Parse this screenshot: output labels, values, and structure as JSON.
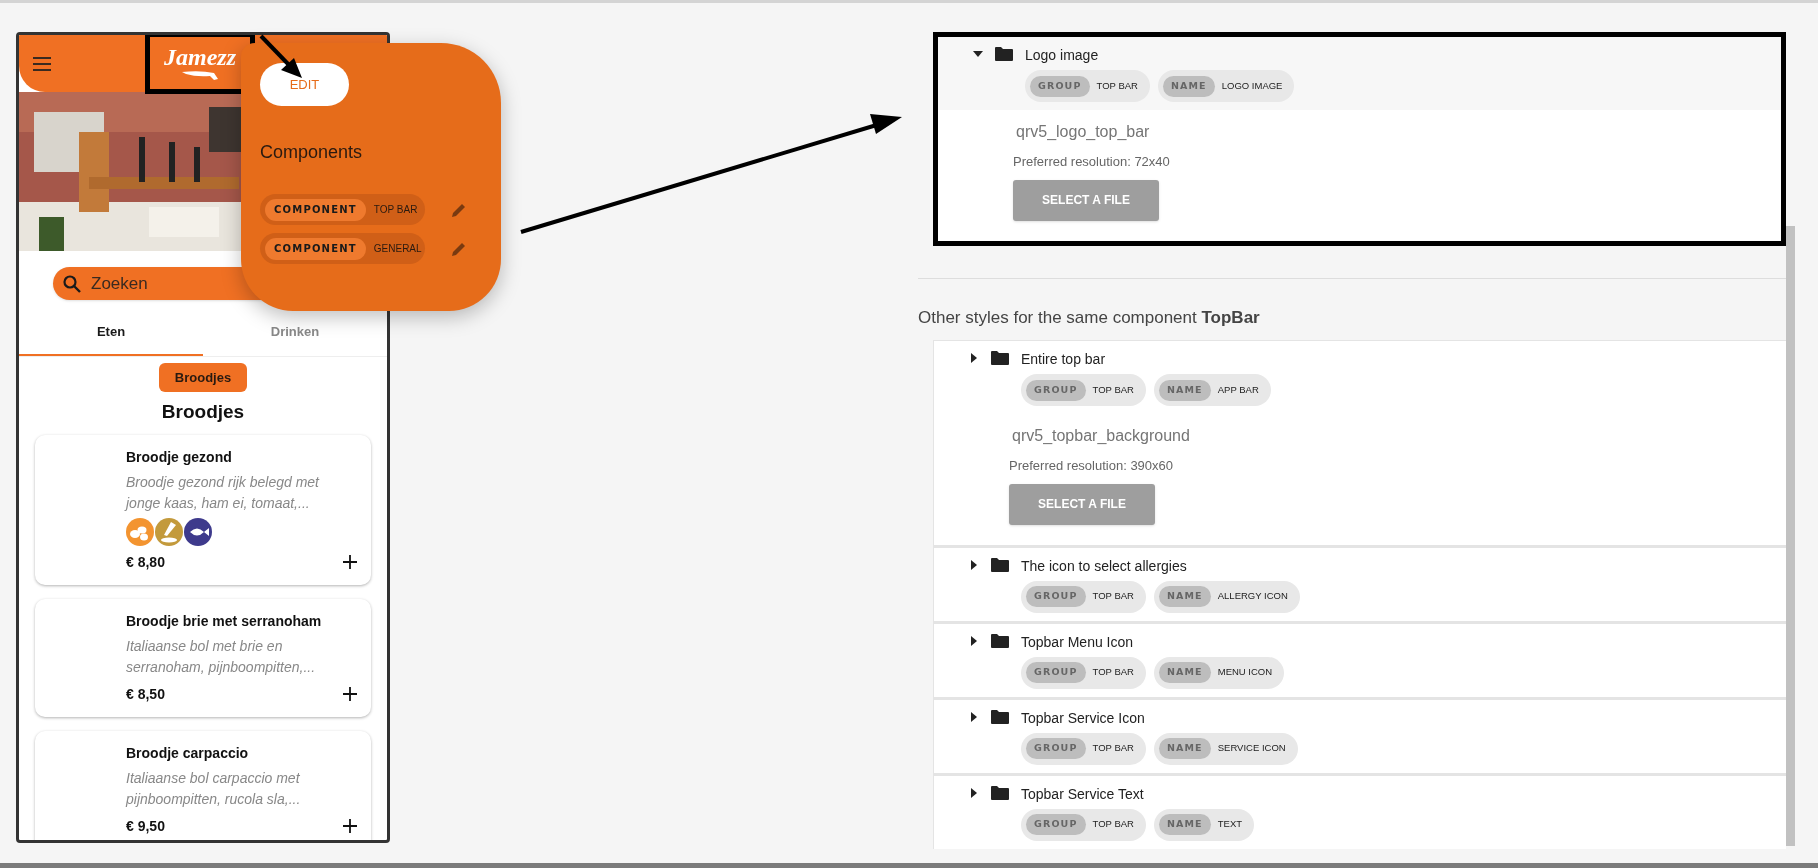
{
  "phone": {
    "logo": "Jamezz",
    "search": {
      "placeholder": "Zoeken"
    },
    "tabs": [
      {
        "label": "Eten",
        "selected": true
      },
      {
        "label": "Drinken",
        "selected": false
      }
    ],
    "category_chip": "Broodjes",
    "section_title": "Broodjes",
    "products": [
      {
        "name": "Broodje gezond",
        "description": "Broodje gezond rijk belegd met jonge kaas, ham ei, tomaat,...",
        "allergens": [
          {
            "kind": "egg",
            "color": "#f39430"
          },
          {
            "kind": "mustard",
            "color": "#c39a3c"
          },
          {
            "kind": "fish",
            "color": "#3e3a8c"
          }
        ],
        "price": "€ 8,80"
      },
      {
        "name": "Broodje brie met serranoham",
        "description": "Italiaanse bol met brie en serranoham, pijnboompitten,...",
        "price": "€ 8,50"
      },
      {
        "name": "Broodje carpaccio",
        "description": "Italiaanse bol carpaccio met pijnboompitten, rucola sla,...",
        "price": "€ 9,50"
      }
    ]
  },
  "popup": {
    "button": "EDIT",
    "title": "Components",
    "components": [
      {
        "label": "COMPONENT",
        "value": "TOP BAR"
      },
      {
        "label": "COMPONENT",
        "value": "GENERAL"
      }
    ]
  },
  "editor": {
    "current": {
      "title": "Logo image",
      "expanded": true,
      "chips": [
        {
          "label": "GROUP",
          "value": "TOP BAR"
        },
        {
          "label": "NAME",
          "value": "LOGO IMAGE"
        }
      ],
      "resource": "qrv5_logo_top_bar",
      "resolution": "Preferred resolution: 72x40",
      "button": "SELECT A FILE"
    },
    "other_heading": "Other styles for the same component **TopBar**",
    "others": [
      {
        "title": "Entire top bar",
        "expanded": false,
        "chips": [
          {
            "label": "GROUP",
            "value": "TOP BAR"
          },
          {
            "label": "NAME",
            "value": "APP BAR"
          }
        ],
        "resource": "qrv5_topbar_background",
        "resolution": "Preferred resolution: 390x60",
        "button": "SELECT A FILE"
      },
      {
        "title": "The icon to select allergies",
        "expanded": false,
        "chips": [
          {
            "label": "GROUP",
            "value": "TOP BAR"
          },
          {
            "label": "NAME",
            "value": "ALLERGY ICON"
          }
        ]
      },
      {
        "title": "Topbar Menu Icon",
        "expanded": false,
        "chips": [
          {
            "label": "GROUP",
            "value": "TOP BAR"
          },
          {
            "label": "NAME",
            "value": "MENU ICON"
          }
        ]
      },
      {
        "title": "Topbar Service Icon",
        "expanded": false,
        "chips": [
          {
            "label": "GROUP",
            "value": "TOP BAR"
          },
          {
            "label": "NAME",
            "value": "SERVICE ICON"
          }
        ]
      },
      {
        "title": "Topbar Service Text",
        "expanded": false,
        "chips": [
          {
            "label": "GROUP",
            "value": "TOP BAR"
          },
          {
            "label": "NAME",
            "value": "TEXT"
          }
        ]
      }
    ]
  }
}
